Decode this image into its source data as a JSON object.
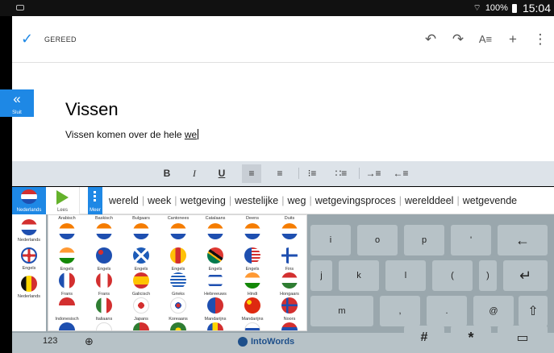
{
  "status_bar": {
    "battery": "100%",
    "time": "15:04"
  },
  "app_bar": {
    "done_label": "GEREED",
    "undo": "↶",
    "redo": "↷",
    "text_format": "A≡",
    "add": "+",
    "more": "⋮"
  },
  "document": {
    "title": "Vissen",
    "body_text": "Vissen komen over de hele ",
    "body_current_word": "we"
  },
  "format_bar": {
    "bold": "B",
    "italic": "I",
    "underline": "U"
  },
  "suggestion_bar": {
    "active_language": "Nederlands",
    "read_label": "Lees",
    "more_label": "Meer",
    "words": [
      "wereld",
      "week",
      "wetgeving",
      "westelijke",
      "weg",
      "wetgevingsproces",
      "werelddeel",
      "wetgevende"
    ]
  },
  "language_sidebar": [
    {
      "label": "Nederlands",
      "flag": "nl"
    },
    {
      "label": "Engels",
      "flag": "uk"
    },
    {
      "label": "Nederlands",
      "flag": "be"
    }
  ],
  "close_label": "Sluit",
  "language_grid": {
    "rows": [
      [
        {
          "label": "Arabisch",
          "flag": "nl"
        },
        {
          "label": "Baskisch",
          "flag": "nl"
        },
        {
          "label": "Bulgaars",
          "flag": "nl"
        },
        {
          "label": "Cantonees",
          "flag": "nl"
        },
        {
          "label": "Catalaans",
          "flag": "nl"
        },
        {
          "label": "Deens",
          "flag": "nl"
        },
        {
          "label": "Duits",
          "flag": "nl"
        }
      ],
      [
        {
          "label": "Engels",
          "flag": "in"
        },
        {
          "label": "Engels",
          "flag": "au"
        },
        {
          "label": "Engels",
          "flag": "sc"
        },
        {
          "label": "Engels",
          "flag": "ca"
        },
        {
          "label": "Engels",
          "flag": "za"
        },
        {
          "label": "Engels",
          "flag": "us"
        },
        {
          "label": "Fins",
          "flag": "fi"
        }
      ],
      [
        {
          "label": "Frans",
          "flag": "fr"
        },
        {
          "label": "Frans",
          "flag": "ca2"
        },
        {
          "label": "Galicisch",
          "flag": "es"
        },
        {
          "label": "Grieks",
          "flag": "gr"
        },
        {
          "label": "Hebreeuws",
          "flag": "il"
        },
        {
          "label": "Hindi",
          "flag": "in"
        },
        {
          "label": "Hongaars",
          "flag": "hu"
        }
      ],
      [
        {
          "label": "Indonesisch",
          "flag": "id"
        },
        {
          "label": "Italiaans",
          "flag": "it"
        },
        {
          "label": "Japans",
          "flag": "jp"
        },
        {
          "label": "Koreaans",
          "flag": "kr"
        },
        {
          "label": "Mandarijns",
          "flag": "tw"
        },
        {
          "label": "Mandarijns",
          "flag": "cn"
        },
        {
          "label": "Noors",
          "flag": "no"
        }
      ],
      [
        {
          "label": "",
          "flag": "a"
        },
        {
          "label": "",
          "flag": "b"
        },
        {
          "label": "",
          "flag": "c"
        },
        {
          "label": "",
          "flag": "d"
        },
        {
          "label": "",
          "flag": "e"
        },
        {
          "label": "",
          "flag": "f"
        },
        {
          "label": "",
          "flag": "g"
        }
      ]
    ]
  },
  "keyboard": {
    "row1": [
      "i",
      "o",
      "p",
      "'",
      "←"
    ],
    "row2": [
      "j",
      "k",
      "l",
      "(",
      ")",
      "↵"
    ],
    "row3": [
      "m",
      ",",
      ".",
      "@",
      "⇧"
    ],
    "row4": [
      "#",
      "*"
    ],
    "key_123": "123",
    "globe": "⊕",
    "brand": "IntoWords"
  },
  "colors": {
    "accent": "#1e88e5",
    "keyboard_bg": "#9aa7ad",
    "key_bg": "#b7c2c7",
    "format_bar_bg": "#dde3e9"
  }
}
